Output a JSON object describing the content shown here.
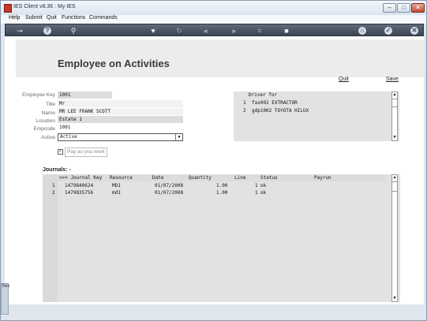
{
  "window": {
    "title": "IES Client v8.36 : My IES"
  },
  "menu": {
    "items": [
      "Help",
      "Submit",
      "Quit",
      "Functions",
      "Commands"
    ]
  },
  "toolbar": {
    "icons": [
      "key-icon",
      "help-icon",
      "search-icon",
      "heart-icon",
      "refresh-icon",
      "rewind-icon",
      "fast-forward-icon",
      "list-icon",
      "stop-icon",
      "home-icon",
      "check-icon",
      "close-icon"
    ]
  },
  "page": {
    "title": "Employee on Activities",
    "quit_label": "Quit",
    "save_label": "Save"
  },
  "form": {
    "employee_key": {
      "label": "Employee Key",
      "value": "1001"
    },
    "title": {
      "label": "Title",
      "value": "Mr"
    },
    "name": {
      "label": "Name",
      "value": "MR LEE FRANK SCOTT"
    },
    "location": {
      "label": "Location",
      "value": "Estate 1"
    },
    "empcode": {
      "label": "Empcode",
      "value": "1001"
    },
    "active": {
      "label": "Active",
      "value": "Active"
    },
    "pay_as_you_work": {
      "label": "Pay as you work",
      "checked": true
    }
  },
  "driver": {
    "header": "Driver for",
    "rows": [
      {
        "n": "1",
        "text": "fas002 EXTRACTOR"
      },
      {
        "n": "2",
        "text": "gdp1002 TOYOTA HILUX"
      }
    ]
  },
  "journals": {
    "title": "Journals: -",
    "columns": [
      ">>> Journal Key",
      "Resource",
      "Date",
      "Quantity",
      "Line",
      "Status",
      "Payrun"
    ],
    "rows": [
      {
        "n": "1",
        "key": "1479840624",
        "resource": "MD1",
        "date": "01/07/2008",
        "quantity": "1.00",
        "line": "1",
        "status": "ok",
        "payrun": ""
      },
      {
        "n": "2",
        "key": "1479835756",
        "resource": "md1",
        "date": "01/07/2008",
        "quantity": "1.00",
        "line": "1",
        "status": "ok",
        "payrun": ""
      }
    ]
  },
  "side": {
    "tab_label": "Ses"
  }
}
